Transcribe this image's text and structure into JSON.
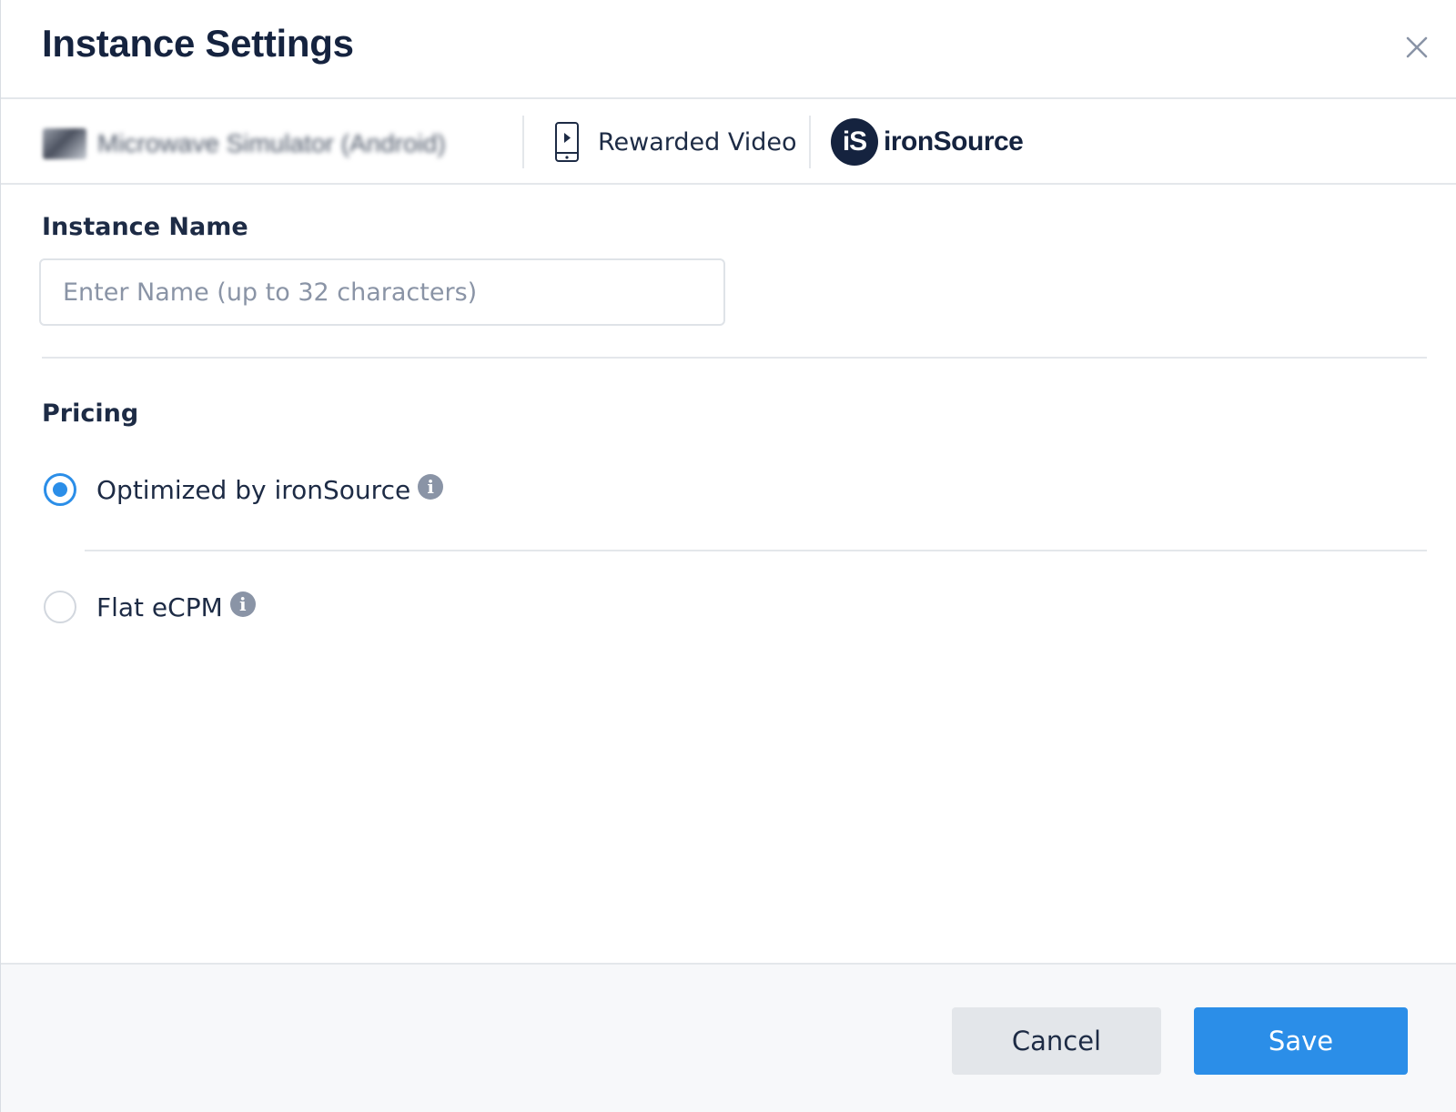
{
  "dialog": {
    "title": "Instance Settings",
    "close_icon": "close-icon"
  },
  "context": {
    "app_name": "Microwave Simulator (Android)",
    "ad_unit": "Rewarded Video",
    "ad_unit_icon": "mobile-video-icon",
    "network_logo_mark": "iS",
    "network_name": "ironSource"
  },
  "instance_name": {
    "label": "Instance Name",
    "value": "",
    "placeholder": "Enter Name (up to 32 characters)"
  },
  "pricing": {
    "label": "Pricing",
    "options": [
      {
        "label": "Optimized by ironSource",
        "selected": true
      },
      {
        "label": "Flat eCPM",
        "selected": false
      }
    ],
    "info_icon": "info-icon"
  },
  "footer": {
    "cancel_label": "Cancel",
    "save_label": "Save"
  },
  "colors": {
    "accent": "#2b8ee8",
    "title": "#15233f",
    "text": "#1d2b45",
    "muted": "#8a94a6"
  }
}
